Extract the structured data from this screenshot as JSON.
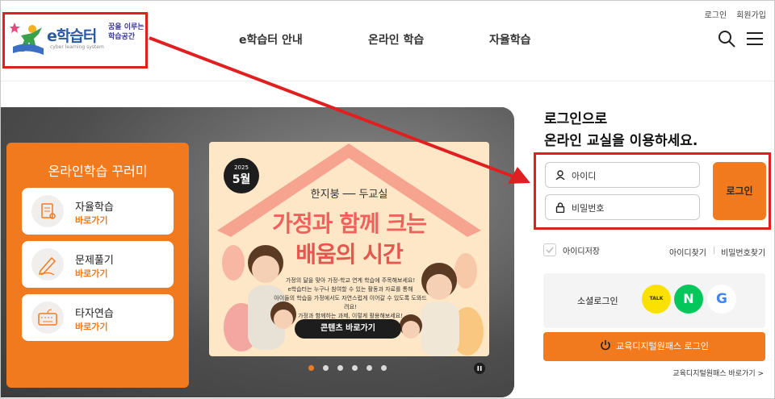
{
  "utility": {
    "login": "로그인",
    "signup": "회원가입"
  },
  "logo": {
    "main": "e학습터",
    "sub": "cyber learning system",
    "slogan_1": "꿈을 이루는",
    "slogan_2": "학습공간"
  },
  "nav": [
    {
      "label": "e학습터 안내"
    },
    {
      "label": "온라인 학습"
    },
    {
      "label": "자율학습"
    }
  ],
  "panel": {
    "title": "온라인학습 꾸러미",
    "items": [
      {
        "label": "자율학습",
        "link": "바로가기",
        "icon": "self-study-icon"
      },
      {
        "label": "문제풀기",
        "link": "바로가기",
        "icon": "pen-writing-icon"
      },
      {
        "label": "타자연습",
        "link": "바로가기",
        "icon": "keyboard-icon"
      }
    ]
  },
  "banner": {
    "year": "2025",
    "month": "5월",
    "subtitle": "한지붕 ── 두교실",
    "title_1": "가정과 함께 크는",
    "title_2": "배움의 시간",
    "body_1": "가정의 달을 맞아 가정-학교 연계 학습에 주목해보세요!",
    "body_2": "e학습터는 누구나 참여할 수 있는 활동과 자료를 통해",
    "body_3": "아이들의 학습을 가정에서도 자연스럽게 이어갈 수 있도록 도와드려요!",
    "body_4": "가정과 함께하는 과제, 이렇게 활용해보세요!",
    "button": "콘텐츠 바로가기",
    "slide_count": 6,
    "active_slide": 1
  },
  "login": {
    "heading_1": "로그인으로",
    "heading_2": "온라인 교실을 이용하세요.",
    "id_placeholder": "아이디",
    "pw_placeholder": "비밀번호",
    "button": "로그인",
    "save_id": "아이디저장",
    "find_id": "아이디찾기",
    "find_pw": "비밀번호찾기",
    "social_label": "소셜로그인",
    "kakao": "TALK",
    "naver": "N",
    "google": "G",
    "digital_pass": "교육디지털원패스 로그인",
    "digital_pass_link": "교육디지털원패스 바로가기 >"
  },
  "colors": {
    "accent": "#f27a1e",
    "highlight": "#e02020",
    "brand": "#2c5aa0"
  }
}
